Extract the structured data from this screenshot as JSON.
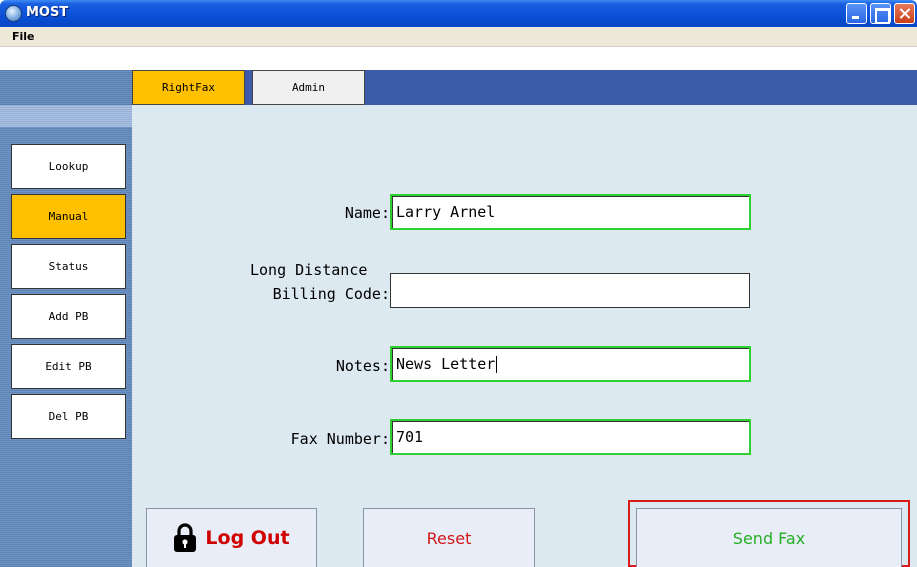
{
  "window": {
    "title": "MOST"
  },
  "menu": {
    "file_label": "File"
  },
  "tabs": [
    {
      "label": "RightFax",
      "active": true
    },
    {
      "label": "Admin",
      "active": false
    }
  ],
  "sidebar": {
    "items": [
      {
        "label": "Lookup",
        "active": false
      },
      {
        "label": "Manual",
        "active": true
      },
      {
        "label": "Status",
        "active": false
      },
      {
        "label": "Add PB",
        "active": false
      },
      {
        "label": "Edit PB",
        "active": false
      },
      {
        "label": "Del PB",
        "active": false
      }
    ]
  },
  "form": {
    "name_label": "Name:",
    "name_value": "Larry Arnel",
    "billing_label_line1": "Long Distance",
    "billing_label_line2": "Billing Code:",
    "billing_value": "",
    "notes_label": "Notes:",
    "notes_value": "News Letter",
    "fax_label": "Fax Number:",
    "fax_value": "701"
  },
  "actions": {
    "logout_label": "Log Out",
    "reset_label": "Reset",
    "send_label": "Send Fax"
  },
  "colors": {
    "accent": "#ffc000",
    "panel": "#dce9f0",
    "tabstrip": "#3b5ba8",
    "valid_border": "#2fd02f",
    "highlight_border": "#d81b1b",
    "logout_text": "#d00000",
    "send_text": "#25b025"
  },
  "icons": {
    "app": "globe-icon",
    "logout": "lock-icon"
  }
}
